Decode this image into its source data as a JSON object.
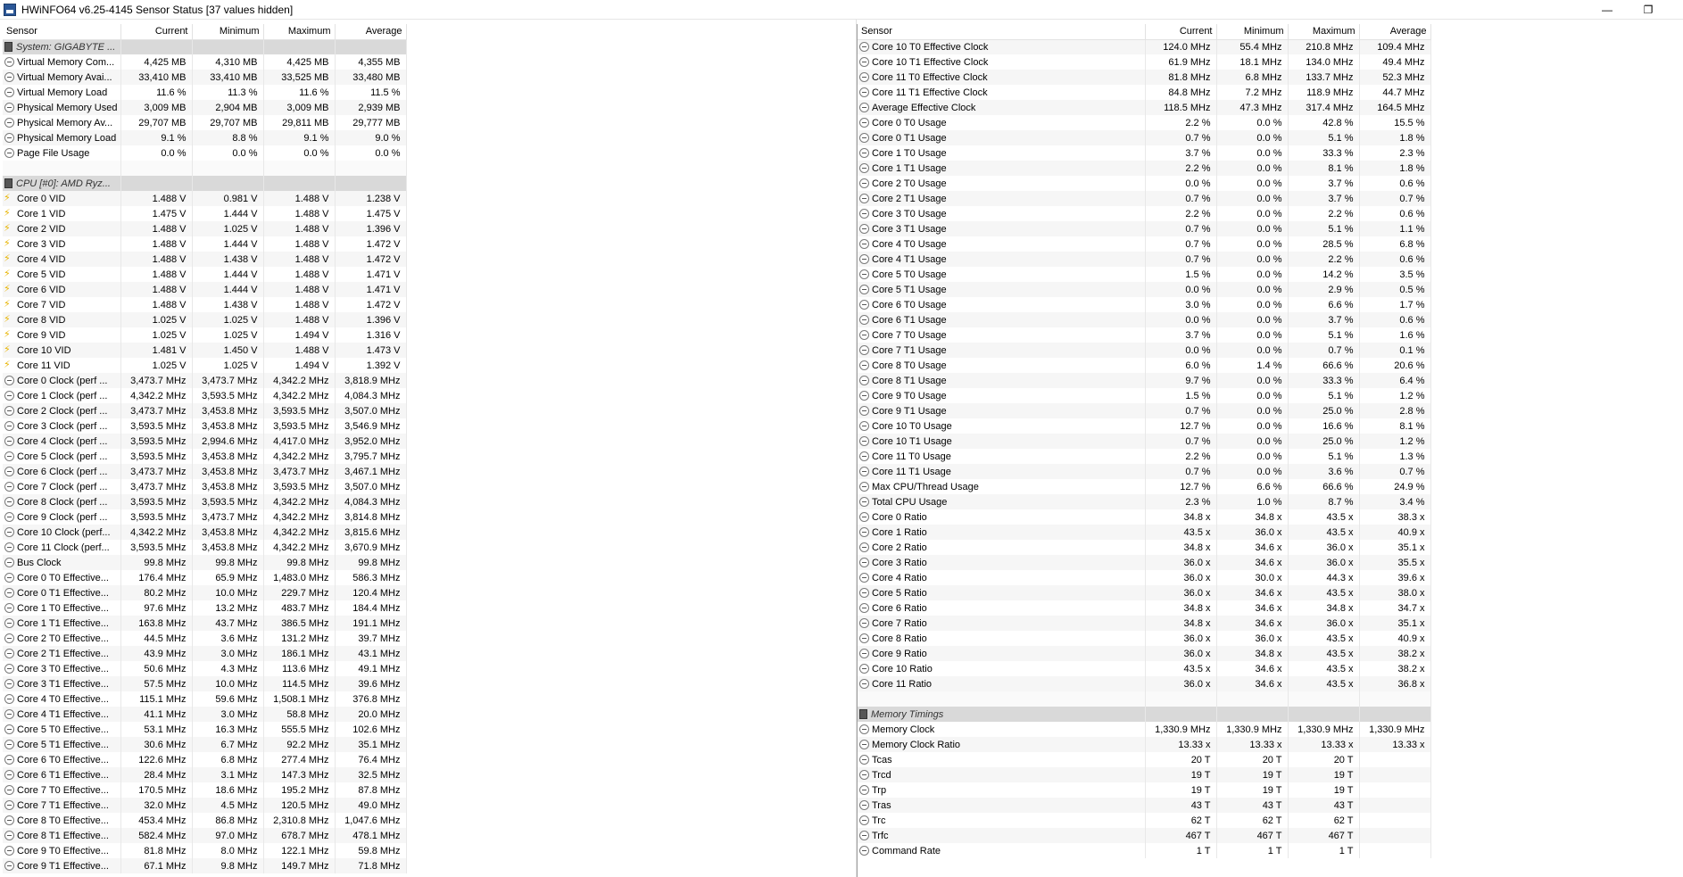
{
  "window": {
    "title": "HWiNFO64 v6.25-4145 Sensor Status [37 values hidden]",
    "minimize_glyph": "—",
    "maximize_glyph": "❐"
  },
  "columns": [
    "Sensor",
    "Current",
    "Minimum",
    "Maximum",
    "Average"
  ],
  "left_rows": [
    {
      "type": "group",
      "name": "System: GIGABYTE ..."
    },
    {
      "icon": "gauge",
      "name": "Virtual Memory Com...",
      "cur": "4,425 MB",
      "min": "4,310 MB",
      "max": "4,425 MB",
      "avg": "4,355 MB"
    },
    {
      "icon": "gauge",
      "name": "Virtual Memory Avai...",
      "cur": "33,410 MB",
      "min": "33,410 MB",
      "max": "33,525 MB",
      "avg": "33,480 MB"
    },
    {
      "icon": "gauge",
      "name": "Virtual Memory Load",
      "cur": "11.6 %",
      "min": "11.3 %",
      "max": "11.6 %",
      "avg": "11.5 %"
    },
    {
      "icon": "gauge",
      "name": "Physical Memory Used",
      "cur": "3,009 MB",
      "min": "2,904 MB",
      "max": "3,009 MB",
      "avg": "2,939 MB"
    },
    {
      "icon": "gauge",
      "name": "Physical Memory Av...",
      "cur": "29,707 MB",
      "min": "29,707 MB",
      "max": "29,811 MB",
      "avg": "29,777 MB"
    },
    {
      "icon": "gauge",
      "name": "Physical Memory Load",
      "cur": "9.1 %",
      "min": "8.8 %",
      "max": "9.1 %",
      "avg": "9.0 %"
    },
    {
      "icon": "gauge",
      "name": "Page File Usage",
      "cur": "0.0 %",
      "min": "0.0 %",
      "max": "0.0 %",
      "avg": "0.0 %"
    },
    {
      "type": "blank"
    },
    {
      "type": "group",
      "name": "CPU [#0]: AMD Ryz..."
    },
    {
      "icon": "bolt",
      "name": "Core 0 VID",
      "cur": "1.488 V",
      "min": "0.981 V",
      "max": "1.488 V",
      "avg": "1.238 V"
    },
    {
      "icon": "bolt",
      "name": "Core 1 VID",
      "cur": "1.475 V",
      "min": "1.444 V",
      "max": "1.488 V",
      "avg": "1.475 V"
    },
    {
      "icon": "bolt",
      "name": "Core 2 VID",
      "cur": "1.488 V",
      "min": "1.025 V",
      "max": "1.488 V",
      "avg": "1.396 V"
    },
    {
      "icon": "bolt",
      "name": "Core 3 VID",
      "cur": "1.488 V",
      "min": "1.444 V",
      "max": "1.488 V",
      "avg": "1.472 V"
    },
    {
      "icon": "bolt",
      "name": "Core 4 VID",
      "cur": "1.488 V",
      "min": "1.438 V",
      "max": "1.488 V",
      "avg": "1.472 V"
    },
    {
      "icon": "bolt",
      "name": "Core 5 VID",
      "cur": "1.488 V",
      "min": "1.444 V",
      "max": "1.488 V",
      "avg": "1.471 V"
    },
    {
      "icon": "bolt",
      "name": "Core 6 VID",
      "cur": "1.488 V",
      "min": "1.444 V",
      "max": "1.488 V",
      "avg": "1.471 V"
    },
    {
      "icon": "bolt",
      "name": "Core 7 VID",
      "cur": "1.488 V",
      "min": "1.438 V",
      "max": "1.488 V",
      "avg": "1.472 V"
    },
    {
      "icon": "bolt",
      "name": "Core 8 VID",
      "cur": "1.025 V",
      "min": "1.025 V",
      "max": "1.488 V",
      "avg": "1.396 V"
    },
    {
      "icon": "bolt",
      "name": "Core 9 VID",
      "cur": "1.025 V",
      "min": "1.025 V",
      "max": "1.494 V",
      "avg": "1.316 V"
    },
    {
      "icon": "bolt",
      "name": "Core 10 VID",
      "cur": "1.481 V",
      "min": "1.450 V",
      "max": "1.488 V",
      "avg": "1.473 V"
    },
    {
      "icon": "bolt",
      "name": "Core 11 VID",
      "cur": "1.025 V",
      "min": "1.025 V",
      "max": "1.494 V",
      "avg": "1.392 V"
    },
    {
      "icon": "gauge",
      "name": "Core 0 Clock (perf ...",
      "cur": "3,473.7 MHz",
      "min": "3,473.7 MHz",
      "max": "4,342.2 MHz",
      "avg": "3,818.9 MHz"
    },
    {
      "icon": "gauge",
      "name": "Core 1 Clock (perf ...",
      "cur": "4,342.2 MHz",
      "min": "3,593.5 MHz",
      "max": "4,342.2 MHz",
      "avg": "4,084.3 MHz"
    },
    {
      "icon": "gauge",
      "name": "Core 2 Clock (perf ...",
      "cur": "3,473.7 MHz",
      "min": "3,453.8 MHz",
      "max": "3,593.5 MHz",
      "avg": "3,507.0 MHz"
    },
    {
      "icon": "gauge",
      "name": "Core 3 Clock (perf ...",
      "cur": "3,593.5 MHz",
      "min": "3,453.8 MHz",
      "max": "3,593.5 MHz",
      "avg": "3,546.9 MHz"
    },
    {
      "icon": "gauge",
      "name": "Core 4 Clock (perf ...",
      "cur": "3,593.5 MHz",
      "min": "2,994.6 MHz",
      "max": "4,417.0 MHz",
      "avg": "3,952.0 MHz"
    },
    {
      "icon": "gauge",
      "name": "Core 5 Clock (perf ...",
      "cur": "3,593.5 MHz",
      "min": "3,453.8 MHz",
      "max": "4,342.2 MHz",
      "avg": "3,795.7 MHz"
    },
    {
      "icon": "gauge",
      "name": "Core 6 Clock (perf ...",
      "cur": "3,473.7 MHz",
      "min": "3,453.8 MHz",
      "max": "3,473.7 MHz",
      "avg": "3,467.1 MHz"
    },
    {
      "icon": "gauge",
      "name": "Core 7 Clock (perf ...",
      "cur": "3,473.7 MHz",
      "min": "3,453.8 MHz",
      "max": "3,593.5 MHz",
      "avg": "3,507.0 MHz"
    },
    {
      "icon": "gauge",
      "name": "Core 8 Clock (perf ...",
      "cur": "3,593.5 MHz",
      "min": "3,593.5 MHz",
      "max": "4,342.2 MHz",
      "avg": "4,084.3 MHz"
    },
    {
      "icon": "gauge",
      "name": "Core 9 Clock (perf ...",
      "cur": "3,593.5 MHz",
      "min": "3,473.7 MHz",
      "max": "4,342.2 MHz",
      "avg": "3,814.8 MHz"
    },
    {
      "icon": "gauge",
      "name": "Core 10 Clock (perf...",
      "cur": "4,342.2 MHz",
      "min": "3,453.8 MHz",
      "max": "4,342.2 MHz",
      "avg": "3,815.6 MHz"
    },
    {
      "icon": "gauge",
      "name": "Core 11 Clock (perf...",
      "cur": "3,593.5 MHz",
      "min": "3,453.8 MHz",
      "max": "4,342.2 MHz",
      "avg": "3,670.9 MHz"
    },
    {
      "icon": "gauge",
      "name": "Bus Clock",
      "cur": "99.8 MHz",
      "min": "99.8 MHz",
      "max": "99.8 MHz",
      "avg": "99.8 MHz"
    },
    {
      "icon": "gauge",
      "name": "Core 0 T0 Effective...",
      "cur": "176.4 MHz",
      "min": "65.9 MHz",
      "max": "1,483.0 MHz",
      "avg": "586.3 MHz"
    },
    {
      "icon": "gauge",
      "name": "Core 0 T1 Effective...",
      "cur": "80.2 MHz",
      "min": "10.0 MHz",
      "max": "229.7 MHz",
      "avg": "120.4 MHz"
    },
    {
      "icon": "gauge",
      "name": "Core 1 T0 Effective...",
      "cur": "97.6 MHz",
      "min": "13.2 MHz",
      "max": "483.7 MHz",
      "avg": "184.4 MHz"
    },
    {
      "icon": "gauge",
      "name": "Core 1 T1 Effective...",
      "cur": "163.8 MHz",
      "min": "43.7 MHz",
      "max": "386.5 MHz",
      "avg": "191.1 MHz"
    },
    {
      "icon": "gauge",
      "name": "Core 2 T0 Effective...",
      "cur": "44.5 MHz",
      "min": "3.6 MHz",
      "max": "131.2 MHz",
      "avg": "39.7 MHz"
    },
    {
      "icon": "gauge",
      "name": "Core 2 T1 Effective...",
      "cur": "43.9 MHz",
      "min": "3.0 MHz",
      "max": "186.1 MHz",
      "avg": "43.1 MHz"
    },
    {
      "icon": "gauge",
      "name": "Core 3 T0 Effective...",
      "cur": "50.6 MHz",
      "min": "4.3 MHz",
      "max": "113.6 MHz",
      "avg": "49.1 MHz"
    },
    {
      "icon": "gauge",
      "name": "Core 3 T1 Effective...",
      "cur": "57.5 MHz",
      "min": "10.0 MHz",
      "max": "114.5 MHz",
      "avg": "39.6 MHz"
    },
    {
      "icon": "gauge",
      "name": "Core 4 T0 Effective...",
      "cur": "115.1 MHz",
      "min": "59.6 MHz",
      "max": "1,508.1 MHz",
      "avg": "376.8 MHz"
    },
    {
      "icon": "gauge",
      "name": "Core 4 T1 Effective...",
      "cur": "41.1 MHz",
      "min": "3.0 MHz",
      "max": "58.8 MHz",
      "avg": "20.0 MHz"
    },
    {
      "icon": "gauge",
      "name": "Core 5 T0 Effective...",
      "cur": "53.1 MHz",
      "min": "16.3 MHz",
      "max": "555.5 MHz",
      "avg": "102.6 MHz"
    },
    {
      "icon": "gauge",
      "name": "Core 5 T1 Effective...",
      "cur": "30.6 MHz",
      "min": "6.7 MHz",
      "max": "92.2 MHz",
      "avg": "35.1 MHz"
    },
    {
      "icon": "gauge",
      "name": "Core 6 T0 Effective...",
      "cur": "122.6 MHz",
      "min": "6.8 MHz",
      "max": "277.4 MHz",
      "avg": "76.4 MHz"
    },
    {
      "icon": "gauge",
      "name": "Core 6 T1 Effective...",
      "cur": "28.4 MHz",
      "min": "3.1 MHz",
      "max": "147.3 MHz",
      "avg": "32.5 MHz"
    },
    {
      "icon": "gauge",
      "name": "Core 7 T0 Effective...",
      "cur": "170.5 MHz",
      "min": "18.6 MHz",
      "max": "195.2 MHz",
      "avg": "87.8 MHz"
    },
    {
      "icon": "gauge",
      "name": "Core 7 T1 Effective...",
      "cur": "32.0 MHz",
      "min": "4.5 MHz",
      "max": "120.5 MHz",
      "avg": "49.0 MHz"
    },
    {
      "icon": "gauge",
      "name": "Core 8 T0 Effective...",
      "cur": "453.4 MHz",
      "min": "86.8 MHz",
      "max": "2,310.8 MHz",
      "avg": "1,047.6 MHz"
    },
    {
      "icon": "gauge",
      "name": "Core 8 T1 Effective...",
      "cur": "582.4 MHz",
      "min": "97.0 MHz",
      "max": "678.7 MHz",
      "avg": "478.1 MHz"
    },
    {
      "icon": "gauge",
      "name": "Core 9 T0 Effective...",
      "cur": "81.8 MHz",
      "min": "8.0 MHz",
      "max": "122.1 MHz",
      "avg": "59.8 MHz"
    },
    {
      "icon": "gauge",
      "name": "Core 9 T1 Effective...",
      "cur": "67.1 MHz",
      "min": "9.8 MHz",
      "max": "149.7 MHz",
      "avg": "71.8 MHz"
    }
  ],
  "right_rows": [
    {
      "icon": "gauge",
      "name": "Core 10 T0 Effective Clock",
      "cur": "124.0 MHz",
      "min": "55.4 MHz",
      "max": "210.8 MHz",
      "avg": "109.4 MHz"
    },
    {
      "icon": "gauge",
      "name": "Core 10 T1 Effective Clock",
      "cur": "61.9 MHz",
      "min": "18.1 MHz",
      "max": "134.0 MHz",
      "avg": "49.4 MHz"
    },
    {
      "icon": "gauge",
      "name": "Core 11 T0 Effective Clock",
      "cur": "81.8 MHz",
      "min": "6.8 MHz",
      "max": "133.7 MHz",
      "avg": "52.3 MHz"
    },
    {
      "icon": "gauge",
      "name": "Core 11 T1 Effective Clock",
      "cur": "84.8 MHz",
      "min": "7.2 MHz",
      "max": "118.9 MHz",
      "avg": "44.7 MHz"
    },
    {
      "icon": "gauge",
      "name": "Average Effective Clock",
      "cur": "118.5 MHz",
      "min": "47.3 MHz",
      "max": "317.4 MHz",
      "avg": "164.5 MHz"
    },
    {
      "icon": "gauge",
      "name": "Core 0 T0 Usage",
      "cur": "2.2 %",
      "min": "0.0 %",
      "max": "42.8 %",
      "avg": "15.5 %"
    },
    {
      "icon": "gauge",
      "name": "Core 0 T1 Usage",
      "cur": "0.7 %",
      "min": "0.0 %",
      "max": "5.1 %",
      "avg": "1.8 %"
    },
    {
      "icon": "gauge",
      "name": "Core 1 T0 Usage",
      "cur": "3.7 %",
      "min": "0.0 %",
      "max": "33.3 %",
      "avg": "2.3 %"
    },
    {
      "icon": "gauge",
      "name": "Core 1 T1 Usage",
      "cur": "2.2 %",
      "min": "0.0 %",
      "max": "8.1 %",
      "avg": "1.8 %"
    },
    {
      "icon": "gauge",
      "name": "Core 2 T0 Usage",
      "cur": "0.0 %",
      "min": "0.0 %",
      "max": "3.7 %",
      "avg": "0.6 %"
    },
    {
      "icon": "gauge",
      "name": "Core 2 T1 Usage",
      "cur": "0.7 %",
      "min": "0.0 %",
      "max": "3.7 %",
      "avg": "0.7 %"
    },
    {
      "icon": "gauge",
      "name": "Core 3 T0 Usage",
      "cur": "2.2 %",
      "min": "0.0 %",
      "max": "2.2 %",
      "avg": "0.6 %"
    },
    {
      "icon": "gauge",
      "name": "Core 3 T1 Usage",
      "cur": "0.7 %",
      "min": "0.0 %",
      "max": "5.1 %",
      "avg": "1.1 %"
    },
    {
      "icon": "gauge",
      "name": "Core 4 T0 Usage",
      "cur": "0.7 %",
      "min": "0.0 %",
      "max": "28.5 %",
      "avg": "6.8 %"
    },
    {
      "icon": "gauge",
      "name": "Core 4 T1 Usage",
      "cur": "0.7 %",
      "min": "0.0 %",
      "max": "2.2 %",
      "avg": "0.6 %"
    },
    {
      "icon": "gauge",
      "name": "Core 5 T0 Usage",
      "cur": "1.5 %",
      "min": "0.0 %",
      "max": "14.2 %",
      "avg": "3.5 %"
    },
    {
      "icon": "gauge",
      "name": "Core 5 T1 Usage",
      "cur": "0.0 %",
      "min": "0.0 %",
      "max": "2.9 %",
      "avg": "0.5 %"
    },
    {
      "icon": "gauge",
      "name": "Core 6 T0 Usage",
      "cur": "3.0 %",
      "min": "0.0 %",
      "max": "6.6 %",
      "avg": "1.7 %"
    },
    {
      "icon": "gauge",
      "name": "Core 6 T1 Usage",
      "cur": "0.0 %",
      "min": "0.0 %",
      "max": "3.7 %",
      "avg": "0.6 %"
    },
    {
      "icon": "gauge",
      "name": "Core 7 T0 Usage",
      "cur": "3.7 %",
      "min": "0.0 %",
      "max": "5.1 %",
      "avg": "1.6 %"
    },
    {
      "icon": "gauge",
      "name": "Core 7 T1 Usage",
      "cur": "0.0 %",
      "min": "0.0 %",
      "max": "0.7 %",
      "avg": "0.1 %"
    },
    {
      "icon": "gauge",
      "name": "Core 8 T0 Usage",
      "cur": "6.0 %",
      "min": "1.4 %",
      "max": "66.6 %",
      "avg": "20.6 %"
    },
    {
      "icon": "gauge",
      "name": "Core 8 T1 Usage",
      "cur": "9.7 %",
      "min": "0.0 %",
      "max": "33.3 %",
      "avg": "6.4 %"
    },
    {
      "icon": "gauge",
      "name": "Core 9 T0 Usage",
      "cur": "1.5 %",
      "min": "0.0 %",
      "max": "5.1 %",
      "avg": "1.2 %"
    },
    {
      "icon": "gauge",
      "name": "Core 9 T1 Usage",
      "cur": "0.7 %",
      "min": "0.0 %",
      "max": "25.0 %",
      "avg": "2.8 %"
    },
    {
      "icon": "gauge",
      "name": "Core 10 T0 Usage",
      "cur": "12.7 %",
      "min": "0.0 %",
      "max": "16.6 %",
      "avg": "8.1 %"
    },
    {
      "icon": "gauge",
      "name": "Core 10 T1 Usage",
      "cur": "0.7 %",
      "min": "0.0 %",
      "max": "25.0 %",
      "avg": "1.2 %"
    },
    {
      "icon": "gauge",
      "name": "Core 11 T0 Usage",
      "cur": "2.2 %",
      "min": "0.0 %",
      "max": "5.1 %",
      "avg": "1.3 %"
    },
    {
      "icon": "gauge",
      "name": "Core 11 T1 Usage",
      "cur": "0.7 %",
      "min": "0.0 %",
      "max": "3.6 %",
      "avg": "0.7 %"
    },
    {
      "icon": "gauge",
      "name": "Max CPU/Thread Usage",
      "cur": "12.7 %",
      "min": "6.6 %",
      "max": "66.6 %",
      "avg": "24.9 %"
    },
    {
      "icon": "gauge",
      "name": "Total CPU Usage",
      "cur": "2.3 %",
      "min": "1.0 %",
      "max": "8.7 %",
      "avg": "3.4 %"
    },
    {
      "icon": "gauge",
      "name": "Core 0 Ratio",
      "cur": "34.8 x",
      "min": "34.8 x",
      "max": "43.5 x",
      "avg": "38.3 x"
    },
    {
      "icon": "gauge",
      "name": "Core 1 Ratio",
      "cur": "43.5 x",
      "min": "36.0 x",
      "max": "43.5 x",
      "avg": "40.9 x"
    },
    {
      "icon": "gauge",
      "name": "Core 2 Ratio",
      "cur": "34.8 x",
      "min": "34.6 x",
      "max": "36.0 x",
      "avg": "35.1 x"
    },
    {
      "icon": "gauge",
      "name": "Core 3 Ratio",
      "cur": "36.0 x",
      "min": "34.6 x",
      "max": "36.0 x",
      "avg": "35.5 x"
    },
    {
      "icon": "gauge",
      "name": "Core 4 Ratio",
      "cur": "36.0 x",
      "min": "30.0 x",
      "max": "44.3 x",
      "avg": "39.6 x"
    },
    {
      "icon": "gauge",
      "name": "Core 5 Ratio",
      "cur": "36.0 x",
      "min": "34.6 x",
      "max": "43.5 x",
      "avg": "38.0 x"
    },
    {
      "icon": "gauge",
      "name": "Core 6 Ratio",
      "cur": "34.8 x",
      "min": "34.6 x",
      "max": "34.8 x",
      "avg": "34.7 x"
    },
    {
      "icon": "gauge",
      "name": "Core 7 Ratio",
      "cur": "34.8 x",
      "min": "34.6 x",
      "max": "36.0 x",
      "avg": "35.1 x"
    },
    {
      "icon": "gauge",
      "name": "Core 8 Ratio",
      "cur": "36.0 x",
      "min": "36.0 x",
      "max": "43.5 x",
      "avg": "40.9 x"
    },
    {
      "icon": "gauge",
      "name": "Core 9 Ratio",
      "cur": "36.0 x",
      "min": "34.8 x",
      "max": "43.5 x",
      "avg": "38.2 x"
    },
    {
      "icon": "gauge",
      "name": "Core 10 Ratio",
      "cur": "43.5 x",
      "min": "34.6 x",
      "max": "43.5 x",
      "avg": "38.2 x"
    },
    {
      "icon": "gauge",
      "name": "Core 11 Ratio",
      "cur": "36.0 x",
      "min": "34.6 x",
      "max": "43.5 x",
      "avg": "36.8 x"
    },
    {
      "type": "blank"
    },
    {
      "type": "group",
      "name": "Memory Timings"
    },
    {
      "icon": "gauge",
      "name": "Memory Clock",
      "cur": "1,330.9 MHz",
      "min": "1,330.9 MHz",
      "max": "1,330.9 MHz",
      "avg": "1,330.9 MHz"
    },
    {
      "icon": "gauge",
      "name": "Memory Clock Ratio",
      "cur": "13.33 x",
      "min": "13.33 x",
      "max": "13.33 x",
      "avg": "13.33 x"
    },
    {
      "icon": "gauge",
      "name": "Tcas",
      "cur": "20 T",
      "min": "20 T",
      "max": "20 T",
      "avg": ""
    },
    {
      "icon": "gauge",
      "name": "Trcd",
      "cur": "19 T",
      "min": "19 T",
      "max": "19 T",
      "avg": ""
    },
    {
      "icon": "gauge",
      "name": "Trp",
      "cur": "19 T",
      "min": "19 T",
      "max": "19 T",
      "avg": ""
    },
    {
      "icon": "gauge",
      "name": "Tras",
      "cur": "43 T",
      "min": "43 T",
      "max": "43 T",
      "avg": ""
    },
    {
      "icon": "gauge",
      "name": "Trc",
      "cur": "62 T",
      "min": "62 T",
      "max": "62 T",
      "avg": ""
    },
    {
      "icon": "gauge",
      "name": "Trfc",
      "cur": "467 T",
      "min": "467 T",
      "max": "467 T",
      "avg": ""
    },
    {
      "icon": "gauge",
      "name": "Command Rate",
      "cur": "1 T",
      "min": "1 T",
      "max": "1 T",
      "avg": ""
    }
  ]
}
